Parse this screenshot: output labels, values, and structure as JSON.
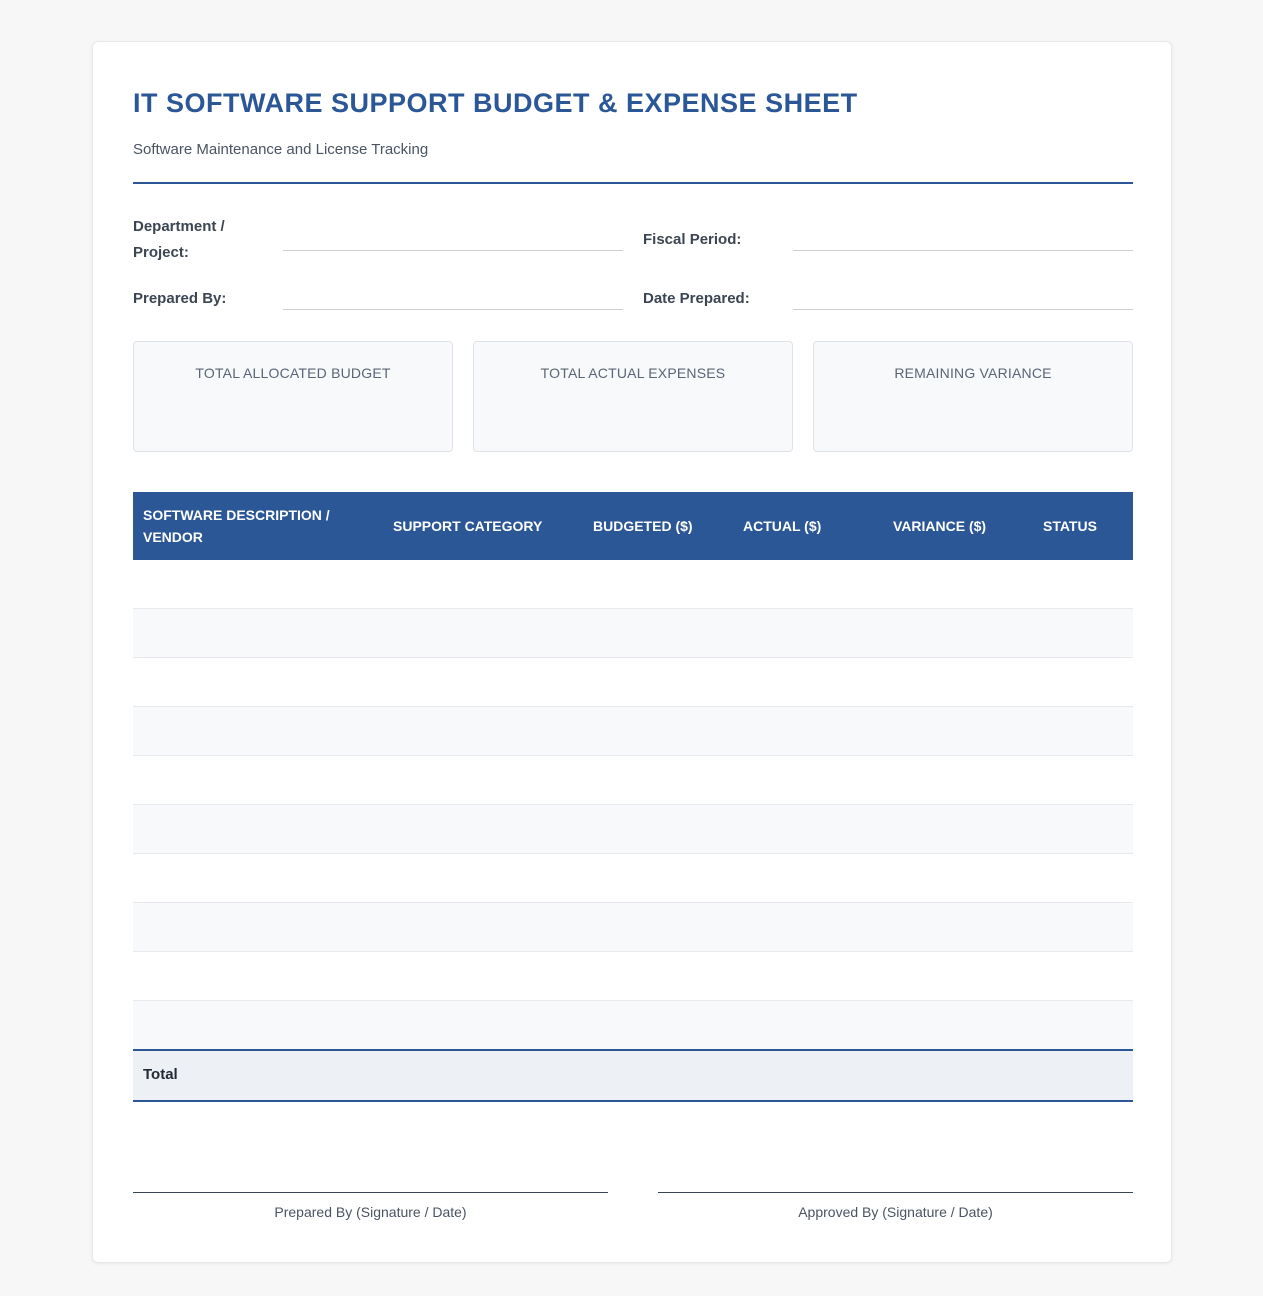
{
  "header": {
    "title": "IT SOFTWARE SUPPORT BUDGET & EXPENSE SHEET",
    "subtitle": "Software Maintenance and License Tracking"
  },
  "fields": {
    "department_line1": "Department /",
    "department_line2": "Project:",
    "fiscal_period": "Fiscal Period:",
    "prepared_by": "Prepared By:",
    "date_prepared": "Date Prepared:"
  },
  "summary": {
    "total_allocated_budget": "TOTAL ALLOCATED BUDGET",
    "total_actual_expenses": "TOTAL ACTUAL EXPENSES",
    "remaining_variance": "REMAINING VARIANCE"
  },
  "table": {
    "columns": {
      "description_line1": "SOFTWARE DESCRIPTION /",
      "description_line2": "VENDOR",
      "support_category": "SUPPORT CATEGORY",
      "budgeted": "BUDGETED ($)",
      "actual": "ACTUAL ($)",
      "variance": "VARIANCE ($)",
      "status": "STATUS"
    },
    "total_label": "Total"
  },
  "signatures": {
    "prepared": "Prepared By (Signature / Date)",
    "approved": "Approved By (Signature / Date)"
  },
  "colors": {
    "accent": "#2b5797",
    "row_alt": "#f7f9fb",
    "total_bg": "#edf1f6"
  }
}
